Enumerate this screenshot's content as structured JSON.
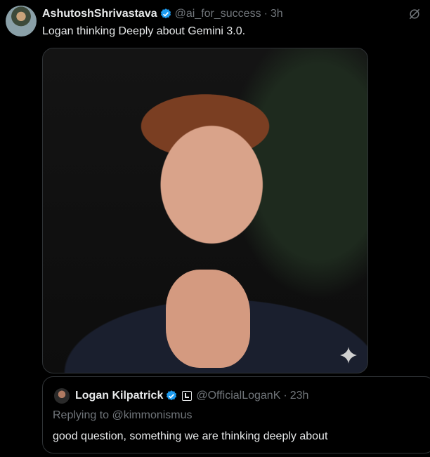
{
  "tweet": {
    "author_name": "AshutoshShrivastava",
    "handle": "@ai_for_success",
    "separator": "·",
    "time": "3h",
    "text": "Logan thinking Deeply about Gemini 3.0.",
    "verified": true,
    "icons": {
      "top_right": "grok-slash-icon",
      "image_badge": "sparkle-icon"
    }
  },
  "quote": {
    "author_name": "Logan Kilpatrick",
    "handle": "@OfficialLoganK",
    "separator": "·",
    "time": "23h",
    "verified": true,
    "replying_prefix": "Replying to",
    "replying_to": "@kimmonismus",
    "text": "good question, something we are thinking deeply about"
  },
  "colors": {
    "background": "#000000",
    "text": "#e7e9ea",
    "muted": "#71767b",
    "verified": "#1d9bf0",
    "border": "#2f3336"
  }
}
